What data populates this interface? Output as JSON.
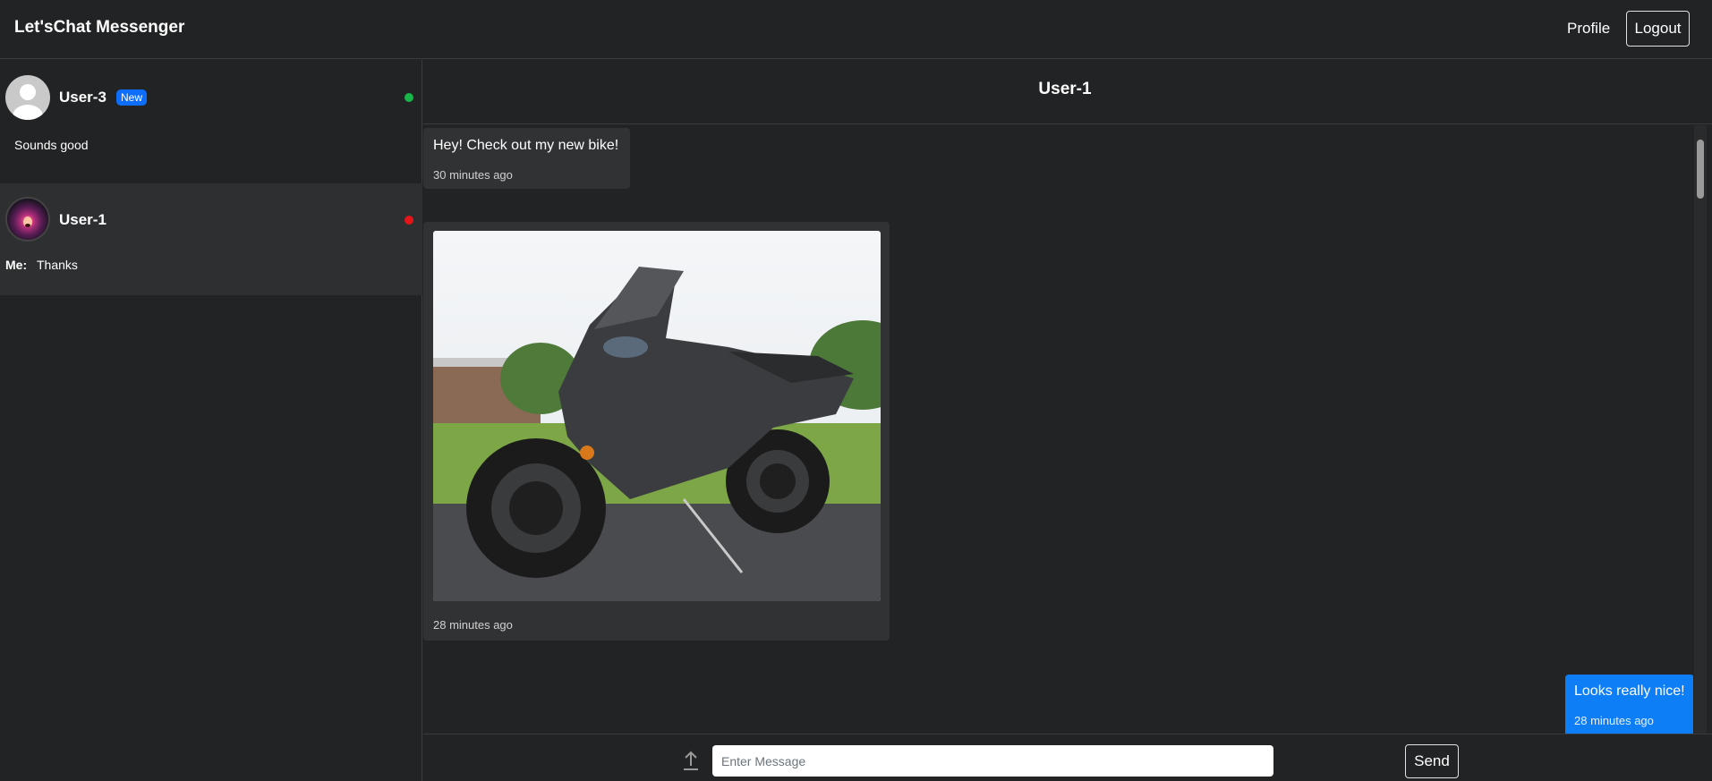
{
  "navbar": {
    "brand": "Let'sChat Messenger",
    "profile_label": "Profile",
    "logout_label": "Logout"
  },
  "sidebar": {
    "conversations": [
      {
        "name": "User-3",
        "badge": "New",
        "status_color": "#18b548",
        "preview": "Sounds good",
        "avatar_icon": "default-user-avatar"
      },
      {
        "name": "User-1",
        "status_color": "#e4161a",
        "preview_prefix": "Me:",
        "preview": "Thanks",
        "avatar_icon": "user-photo-avatar",
        "selected": true
      }
    ]
  },
  "chat": {
    "title": "User-1",
    "messages": [
      {
        "from": "other",
        "type": "text",
        "text": "Hey! Check out my new bike!",
        "time": "30 minutes ago"
      },
      {
        "from": "other",
        "type": "image",
        "image_subject": "motorcycle-photo",
        "time": "28 minutes ago"
      },
      {
        "from": "me",
        "type": "text",
        "text": "Looks really nice!",
        "time": "28 minutes ago"
      }
    ]
  },
  "composer": {
    "upload_icon": "upload-icon",
    "placeholder": "Enter Message",
    "value": "",
    "send_label": "Send"
  },
  "colors": {
    "background": "#222325",
    "bubble_incoming": "#313234",
    "bubble_outgoing": "#0d7ef5",
    "badge": "#0d6efd"
  }
}
